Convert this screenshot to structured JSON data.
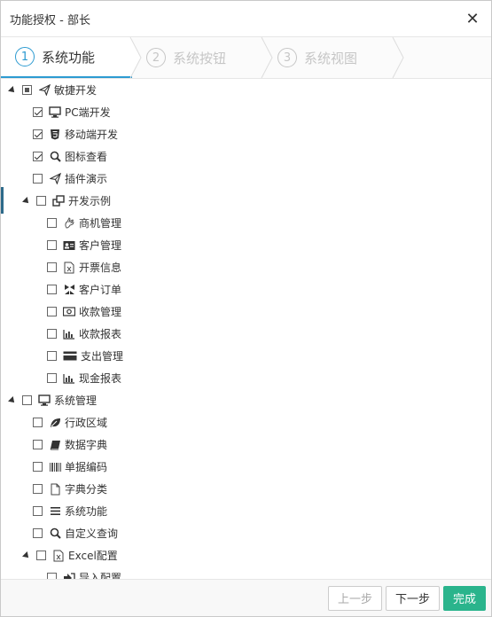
{
  "dialog": {
    "title": "功能授权 - 部长",
    "close_glyph": "✕"
  },
  "steps": [
    {
      "num": "1",
      "label": "系统功能",
      "state": "active"
    },
    {
      "num": "2",
      "label": "系统按钮",
      "state": "inactive"
    },
    {
      "num": "3",
      "label": "系统视图",
      "state": "inactive"
    }
  ],
  "tree": {
    "groups": {
      "quick": {
        "label": "敏捷开发",
        "check": "partial",
        "icon": "paper-plane-icon"
      },
      "sys": {
        "label": "系统管理",
        "check": "unchecked",
        "icon": "monitor-icon"
      }
    },
    "quick_items": [
      {
        "label": "PC端开发",
        "check": "checked",
        "icon": "monitor-icon"
      },
      {
        "label": "移动端开发",
        "check": "checked",
        "icon": "html5-icon"
      },
      {
        "label": "图标查看",
        "check": "checked",
        "icon": "search-icon"
      },
      {
        "label": "插件演示",
        "check": "unchecked",
        "icon": "paper-plane-icon"
      }
    ],
    "example": {
      "label": "开发示例",
      "check": "unchecked",
      "icon": "clone-icon"
    },
    "example_items": [
      {
        "label": "商机管理",
        "icon": "hand-icon"
      },
      {
        "label": "客户管理",
        "icon": "id-card-icon"
      },
      {
        "label": "开票信息",
        "icon": "excel-file-icon"
      },
      {
        "label": "客户订单",
        "icon": "cube-icon"
      },
      {
        "label": "收款管理",
        "icon": "money-icon"
      },
      {
        "label": "收款报表",
        "icon": "bar-chart-icon"
      },
      {
        "label": "支出管理",
        "icon": "credit-card-icon"
      },
      {
        "label": "现金报表",
        "icon": "bar-chart-icon"
      }
    ],
    "sys_items": [
      {
        "label": "行政区域",
        "icon": "leaf-icon"
      },
      {
        "label": "数据字典",
        "icon": "book-icon"
      },
      {
        "label": "单据编码",
        "icon": "barcode-icon"
      },
      {
        "label": "字典分类",
        "icon": "file-icon"
      },
      {
        "label": "系统功能",
        "icon": "list-icon"
      },
      {
        "label": "自定义查询",
        "icon": "search-icon"
      }
    ],
    "excel": {
      "label": "Excel配置",
      "icon": "excel-file-icon"
    },
    "excel_items": [
      {
        "label": "导入配置",
        "icon": "sign-in-icon"
      }
    ]
  },
  "footer": {
    "prev": "上一步",
    "next": "下一步",
    "finish": "完成"
  },
  "colors": {
    "accent": "#2d9bd1",
    "primary_button": "#2ab48c"
  }
}
